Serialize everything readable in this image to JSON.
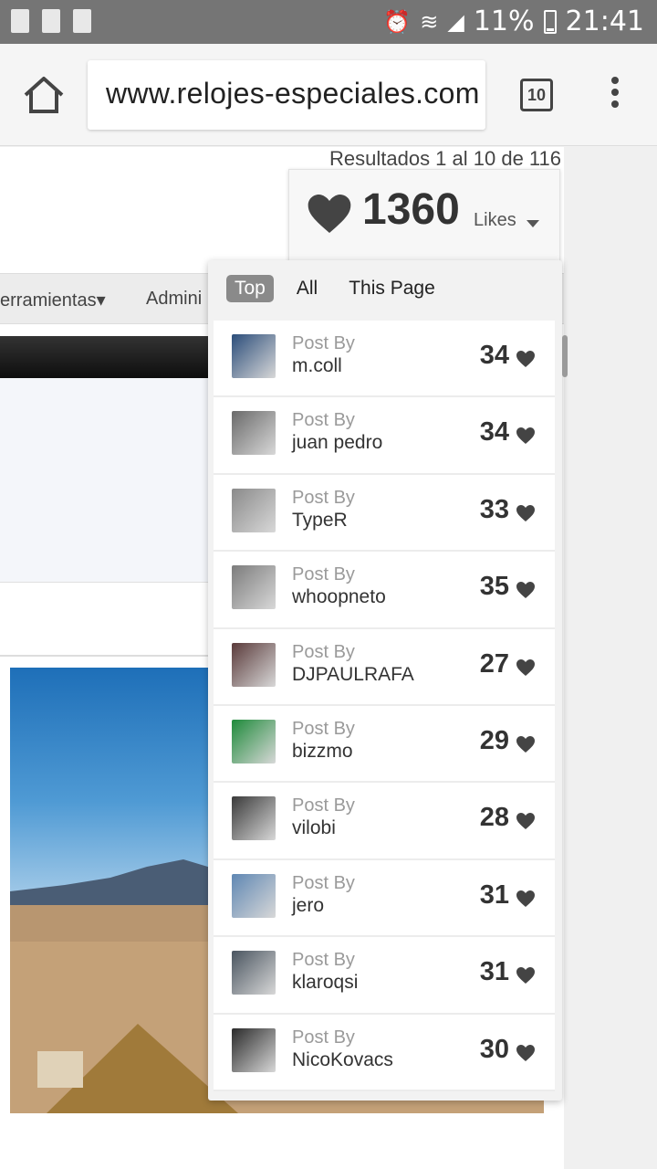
{
  "status_bar": {
    "battery": "11%",
    "time": "21:41",
    "left_icons": [
      "alert-icon",
      "recycle-icon",
      "flipboard-icon"
    ],
    "right_icons": [
      "alarm-icon",
      "wifi-icon",
      "signal-icon",
      "battery-icon"
    ]
  },
  "browser": {
    "url": "www.relojes-especiales.com",
    "tab_count": "10"
  },
  "page": {
    "results_text": "Resultados 1 al 10 de 116",
    "nav_items": [
      "erramientas",
      "Admini"
    ]
  },
  "likes": {
    "total": "1360",
    "label": "Likes"
  },
  "dropdown": {
    "tabs": [
      "Top",
      "All",
      "This Page"
    ],
    "active_tab": "Top",
    "post_by_label": "Post By",
    "entries": [
      {
        "user": "m.coll",
        "count": "34"
      },
      {
        "user": "juan pedro",
        "count": "34"
      },
      {
        "user": "TypeR",
        "count": "33"
      },
      {
        "user": "whoopneto",
        "count": "35"
      },
      {
        "user": "DJPAULRAFA",
        "count": "27"
      },
      {
        "user": "bizzmo",
        "count": "29"
      },
      {
        "user": "vilobi",
        "count": "28"
      },
      {
        "user": "jero",
        "count": "31"
      },
      {
        "user": "klaroqsi",
        "count": "31"
      },
      {
        "user": "NicoKovacs",
        "count": "30"
      }
    ]
  },
  "colors": {
    "status_bar": "#757575",
    "active_tab": "#8a8a8a",
    "heart": "#444444"
  }
}
